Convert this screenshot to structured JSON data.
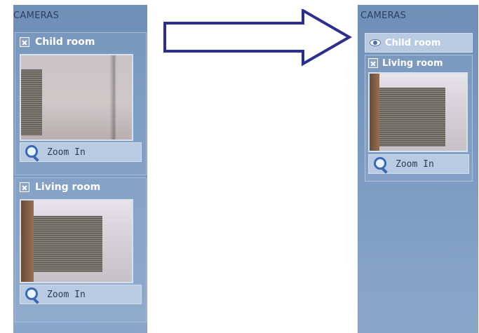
{
  "left_panel": {
    "title": "CAMERAS",
    "cameras": [
      {
        "name": "Child room",
        "zoom_label": "Zoom In"
      },
      {
        "name": "Living room",
        "zoom_label": "Zoom In"
      }
    ]
  },
  "right_panel": {
    "title": "CAMERAS",
    "minimized_camera": {
      "name": "Child room"
    },
    "cameras": [
      {
        "name": "Living room",
        "zoom_label": "Zoom In"
      }
    ]
  },
  "colors": {
    "panel_blue": "#7e9cc3",
    "arrow_stroke": "#2b2f8f",
    "zoom_bar": "#b9cbe3"
  },
  "icons": [
    "close-icon",
    "eye-icon",
    "magnifier-icon",
    "arrow-right-icon"
  ]
}
